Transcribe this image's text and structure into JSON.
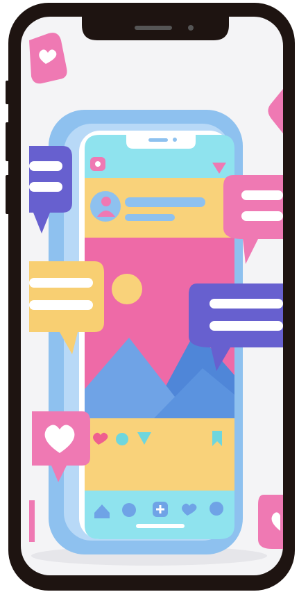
{
  "image": {
    "kind": "3d-illustration",
    "subject": "smartphone-showing-social-media-post",
    "colors": {
      "device_frame": "#1e1411",
      "screen_bg": "#f4f4f6",
      "phone_body": "#8ec1ef",
      "screen_cyan": "#8fe3ee",
      "header_yellow": "#f9d27a",
      "photo_pink": "#ee6aa7",
      "mountain_blue": "#6fa3e6",
      "bubble_pink": "#ef79b3",
      "bubble_purple": "#6760cf",
      "bubble_yellow": "#f8cf72",
      "bubble_white": "#ffffff"
    },
    "icons": [
      "heart-icon",
      "comment-icon",
      "send-icon",
      "bookmark-icon",
      "home-icon",
      "search-icon",
      "add-icon",
      "profile-icon"
    ]
  }
}
